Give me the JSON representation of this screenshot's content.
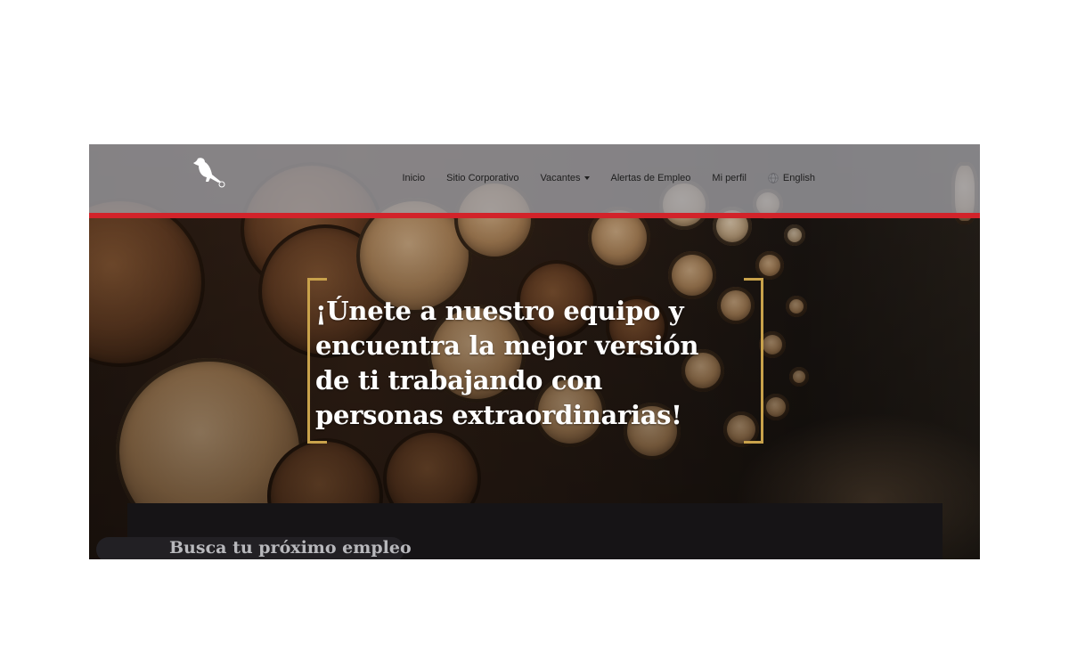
{
  "nav": {
    "items": [
      {
        "label": "Inicio"
      },
      {
        "label": "Sitio Corporativo"
      },
      {
        "label": "Vacantes"
      },
      {
        "label": "Alertas de Empleo"
      },
      {
        "label": "Mi perfil"
      },
      {
        "label": "English"
      }
    ]
  },
  "hero": {
    "title_line1": "¡Únete a nuestro equipo y",
    "title_line2": "encuentra la mejor versión",
    "title_line3": "de ti trabajando con",
    "title_line4": "personas extraordinarias!"
  },
  "search": {
    "title": "Busca tu próximo empleo"
  },
  "icons": {
    "logo": "crow-bird-logo",
    "vacantes_dropdown": "caret-down-icon",
    "language": "globe-icon"
  },
  "colors": {
    "nav_accent": "#d2232a",
    "bracket_gold": "#c9a24b",
    "nav_bg": "#a0a0a5"
  }
}
